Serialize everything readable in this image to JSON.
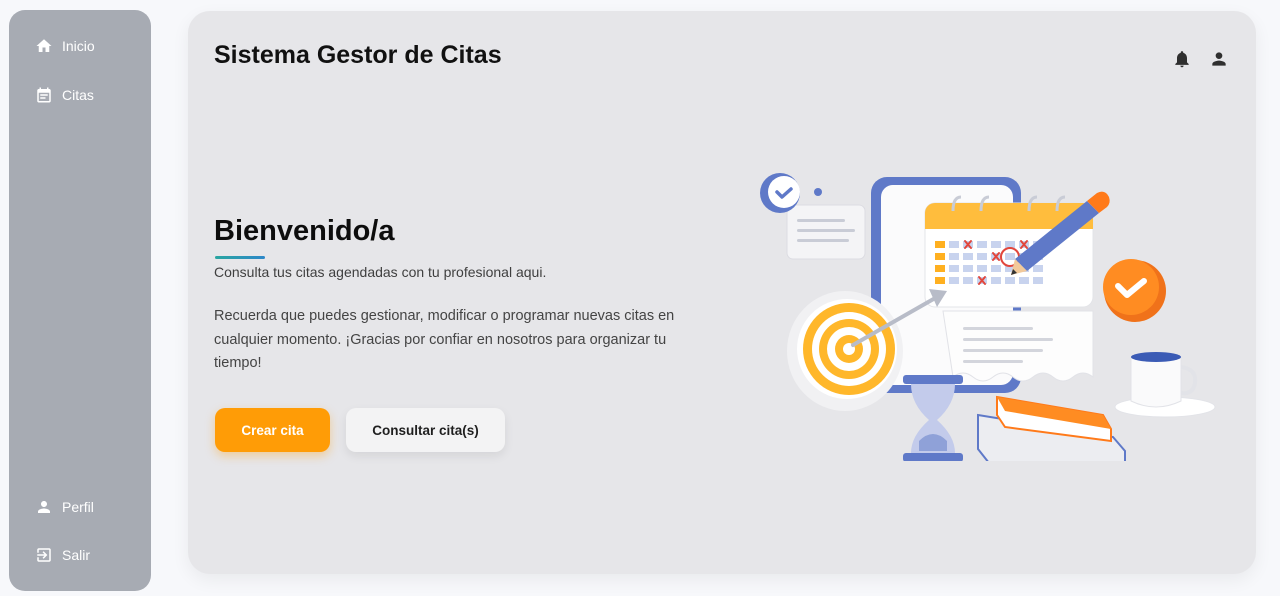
{
  "sidebar": {
    "items": [
      {
        "label": "Inicio",
        "icon": "home-icon"
      },
      {
        "label": "Citas",
        "icon": "calendar-icon"
      },
      {
        "label": "Perfil",
        "icon": "person-icon"
      },
      {
        "label": "Salir",
        "icon": "logout-icon"
      }
    ]
  },
  "header": {
    "title": "Sistema Gestor de Citas",
    "icons": [
      "bell-icon",
      "user-icon"
    ]
  },
  "hero": {
    "title": "Bienvenido/a",
    "subtitle": "Consulta tus citas agendadas con tu profesional aqui.",
    "body": "Recuerda que puedes gestionar, modificar o programar nuevas citas en cualquier momento. ¡Gracias por confiar en nosotros para organizar tu tiempo!",
    "primary_button": "Crear cita",
    "secondary_button": "Consultar cita(s)"
  },
  "colors": {
    "sidebar": "#a7abb3",
    "main_panel": "#e6e6e9",
    "accent": "#ff9c06",
    "underline": "#2aa6a1"
  }
}
